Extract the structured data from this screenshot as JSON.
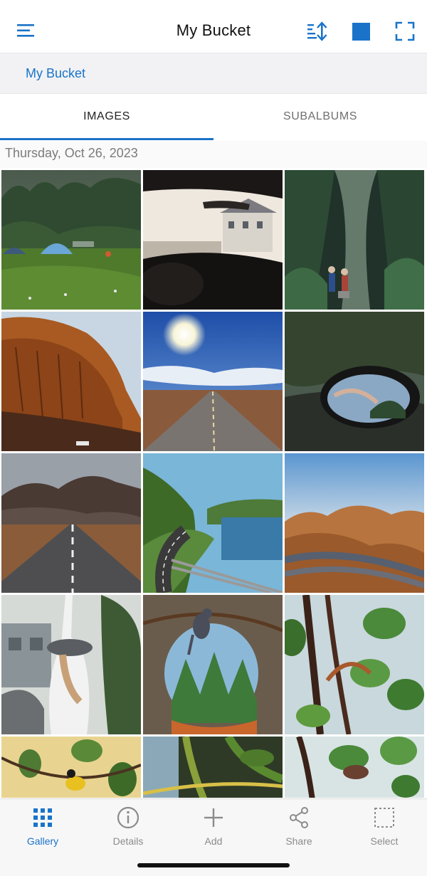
{
  "header": {
    "title": "My Bucket",
    "icons": [
      "menu-icon",
      "sort-icon",
      "square-icon",
      "fullscreen-icon"
    ],
    "accent": "#1a73c9"
  },
  "breadcrumb": {
    "label": "My Bucket"
  },
  "tabs": [
    {
      "label": "IMAGES",
      "active": true
    },
    {
      "label": "SUBALBUMS",
      "active": false
    }
  ],
  "section": {
    "date": "Thursday, Oct 26, 2023"
  },
  "photos": [
    "campsite-meadow-photo",
    "car-windshield-house-photo",
    "hikers-forest-path-photo",
    "red-cliff-photo",
    "sunny-desert-road-photo",
    "car-mirror-hand-photo",
    "mountain-road-photo",
    "lake-coast-road-photo",
    "canyon-road-photo",
    "woman-hat-car-photo",
    "bird-rock-window-photo",
    "tropical-leaves-photo",
    "yellow-bird-leaves-photo",
    "green-plants-photo",
    "moth-leaves-photo"
  ],
  "bottom_nav": [
    {
      "label": "Gallery",
      "icon": "grid-icon",
      "active": true
    },
    {
      "label": "Details",
      "icon": "info-icon",
      "active": false
    },
    {
      "label": "Add",
      "icon": "plus-icon",
      "active": false
    },
    {
      "label": "Share",
      "icon": "share-icon",
      "active": false
    },
    {
      "label": "Select",
      "icon": "select-icon",
      "active": false
    }
  ]
}
